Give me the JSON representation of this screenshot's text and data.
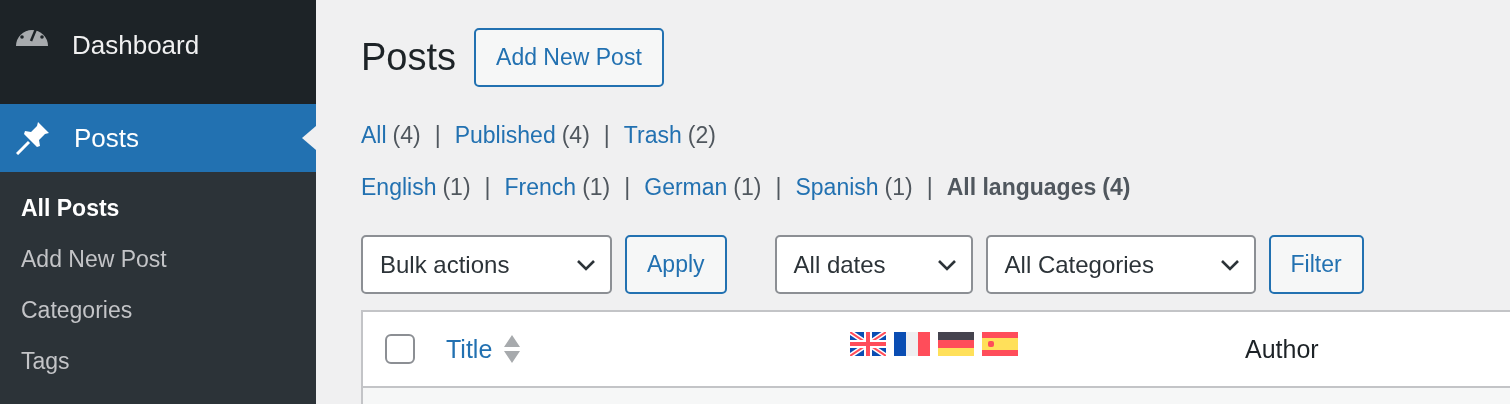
{
  "sidebar": {
    "items": [
      {
        "label": "Dashboard",
        "selected": false
      },
      {
        "label": "Posts",
        "selected": true
      }
    ],
    "submenu": [
      {
        "label": "All Posts",
        "selected": true
      },
      {
        "label": "Add New Post",
        "selected": false
      },
      {
        "label": "Categories",
        "selected": false
      },
      {
        "label": "Tags",
        "selected": false
      }
    ]
  },
  "page": {
    "title": "Posts",
    "add_button": "Add New Post"
  },
  "status_filters": {
    "separator": "|",
    "items": [
      {
        "label": "All",
        "count": "(4)",
        "selected": false
      },
      {
        "label": "Published",
        "count": "(4)",
        "selected": false
      },
      {
        "label": "Trash",
        "count": "(2)",
        "selected": false
      }
    ]
  },
  "language_filters": {
    "separator": "|",
    "items": [
      {
        "label": "English",
        "count": "(1)",
        "selected": false
      },
      {
        "label": "French",
        "count": "(1)",
        "selected": false
      },
      {
        "label": "German",
        "count": "(1)",
        "selected": false
      },
      {
        "label": "Spanish",
        "count": "(1)",
        "selected": false
      },
      {
        "label": "All languages",
        "count": "(4)",
        "selected": true
      }
    ]
  },
  "toolbar": {
    "bulk_select": "Bulk actions",
    "apply": "Apply",
    "date_select": "All dates",
    "category_select": "All Categories",
    "filter": "Filter"
  },
  "table": {
    "select_all_checked": false,
    "columns": [
      {
        "kind": "title",
        "label": "Title"
      },
      {
        "kind": "flags"
      },
      {
        "kind": "text",
        "label": "Author"
      }
    ]
  }
}
